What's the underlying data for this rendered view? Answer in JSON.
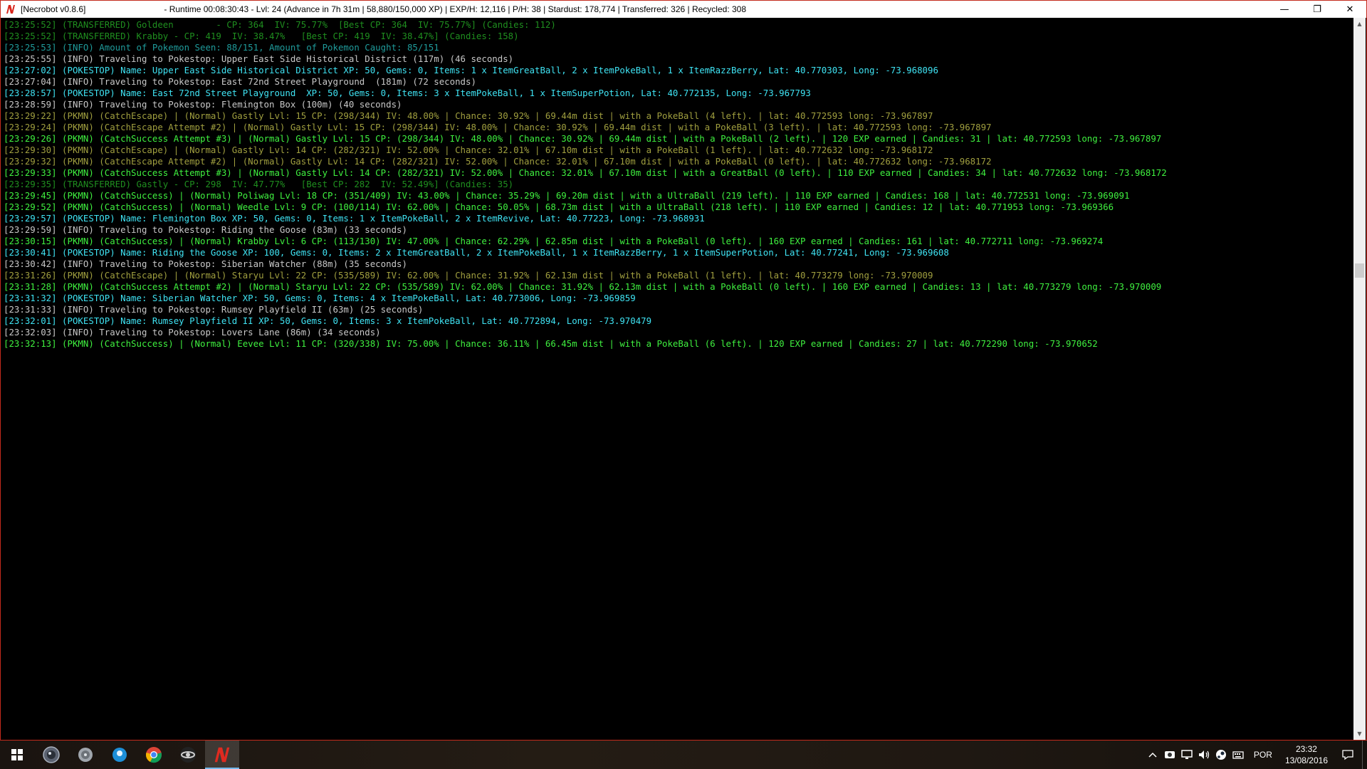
{
  "window": {
    "title": "[Necrobot v0.8.6]",
    "status": "- Runtime 00:08:30:43 - Lvl: 24 (Advance in 7h 31m | 58,880/150,000 XP) | EXP/H: 12,116 | P/H: 38 | Stardust: 178,774 | Transferred: 326 | Recycled: 308",
    "minimize": "—",
    "restore": "❐",
    "close": "✕",
    "app_icon": "necrobot-logo-icon"
  },
  "console": {
    "lines": [
      {
        "text": "[23:25:52] (TRANSFERRED) Goldeen        - CP: 364  IV: 75.77%  [Best CP: 364  IV: 75.77%] (Candies: 112)",
        "color": "dkgreen"
      },
      {
        "text": "[23:25:52] (TRANSFERRED) Krabby - CP: 419  IV: 38.47%   [Best CP: 419  IV: 38.47%] (Candies: 158)",
        "color": "dkgreen"
      },
      {
        "text": "[23:25:53] (INFO) Amount of Pokemon Seen: 88/151, Amount of Pokemon Caught: 85/151",
        "color": "dkcyan"
      },
      {
        "text": "[23:25:55] (INFO) Traveling to Pokestop: Upper East Side Historical District (117m) (46 seconds)",
        "color": "white"
      },
      {
        "text": "[23:27:02] (POKESTOP) Name: Upper East Side Historical District XP: 50, Gems: 0, Items: 1 x ItemGreatBall, 2 x ItemPokeBall, 1 x ItemRazzBerry, Lat: 40.770303, Long: -73.968096",
        "color": "cyan"
      },
      {
        "text": "[23:27:04] (INFO) Traveling to Pokestop: East 72nd Street Playground  (181m) (72 seconds)",
        "color": "white"
      },
      {
        "text": "[23:28:57] (POKESTOP) Name: East 72nd Street Playground  XP: 50, Gems: 0, Items: 3 x ItemPokeBall, 1 x ItemSuperPotion, Lat: 40.772135, Long: -73.967793",
        "color": "cyan"
      },
      {
        "text": "[23:28:59] (INFO) Traveling to Pokestop: Flemington Box (100m) (40 seconds)",
        "color": "white"
      },
      {
        "text": "[23:29:22] (PKMN) (CatchEscape) | (Normal) Gastly Lvl: 15 CP: (298/344) IV: 48.00% | Chance: 30.92% | 69.44m dist | with a PokeBall (4 left). | lat: 40.772593 long: -73.967897",
        "color": "olive"
      },
      {
        "text": "[23:29:24] (PKMN) (CatchEscape Attempt #2) | (Normal) Gastly Lvl: 15 CP: (298/344) IV: 48.00% | Chance: 30.92% | 69.44m dist | with a PokeBall (3 left). | lat: 40.772593 long: -73.967897",
        "color": "olive"
      },
      {
        "text": "[23:29:26] (PKMN) (CatchSuccess Attempt #3) | (Normal) Gastly Lvl: 15 CP: (298/344) IV: 48.00% | Chance: 30.92% | 69.44m dist | with a PokeBall (2 left). | 120 EXP earned | Candies: 31 | lat: 40.772593 long: -73.967897",
        "color": "green"
      },
      {
        "text": "[23:29:30] (PKMN) (CatchEscape) | (Normal) Gastly Lvl: 14 CP: (282/321) IV: 52.00% | Chance: 32.01% | 67.10m dist | with a PokeBall (1 left). | lat: 40.772632 long: -73.968172",
        "color": "olive"
      },
      {
        "text": "[23:29:32] (PKMN) (CatchEscape Attempt #2) | (Normal) Gastly Lvl: 14 CP: (282/321) IV: 52.00% | Chance: 32.01% | 67.10m dist | with a PokeBall (0 left). | lat: 40.772632 long: -73.968172",
        "color": "olive"
      },
      {
        "text": "[23:29:33] (PKMN) (CatchSuccess Attempt #3) | (Normal) Gastly Lvl: 14 CP: (282/321) IV: 52.00% | Chance: 32.01% | 67.10m dist | with a GreatBall (0 left). | 110 EXP earned | Candies: 34 | lat: 40.772632 long: -73.968172",
        "color": "green"
      },
      {
        "text": "[23:29:35] (TRANSFERRED) Gastly - CP: 298  IV: 47.77%   [Best CP: 282  IV: 52.49%] (Candies: 35)",
        "color": "dkgreen"
      },
      {
        "text": "[23:29:45] (PKMN) (CatchSuccess) | (Normal) Poliwag Lvl: 18 CP: (351/409) IV: 43.00% | Chance: 35.29% | 69.20m dist | with a UltraBall (219 left). | 110 EXP earned | Candies: 168 | lat: 40.772531 long: -73.969091",
        "color": "green"
      },
      {
        "text": "[23:29:52] (PKMN) (CatchSuccess) | (Normal) Weedle Lvl: 9 CP: (100/114) IV: 62.00% | Chance: 50.05% | 68.73m dist | with a UltraBall (218 left). | 110 EXP earned | Candies: 12 | lat: 40.771953 long: -73.969366",
        "color": "green"
      },
      {
        "text": "[23:29:57] (POKESTOP) Name: Flemington Box XP: 50, Gems: 0, Items: 1 x ItemPokeBall, 2 x ItemRevive, Lat: 40.77223, Long: -73.968931",
        "color": "cyan"
      },
      {
        "text": "[23:29:59] (INFO) Traveling to Pokestop: Riding the Goose (83m) (33 seconds)",
        "color": "white"
      },
      {
        "text": "[23:30:15] (PKMN) (CatchSuccess) | (Normal) Krabby Lvl: 6 CP: (113/130) IV: 47.00% | Chance: 62.29% | 62.85m dist | with a PokeBall (0 left). | 160 EXP earned | Candies: 161 | lat: 40.772711 long: -73.969274",
        "color": "green"
      },
      {
        "text": "[23:30:41] (POKESTOP) Name: Riding the Goose XP: 100, Gems: 0, Items: 2 x ItemGreatBall, 2 x ItemPokeBall, 1 x ItemRazzBerry, 1 x ItemSuperPotion, Lat: 40.77241, Long: -73.969608",
        "color": "cyan"
      },
      {
        "text": "[23:30:42] (INFO) Traveling to Pokestop: Siberian Watcher (88m) (35 seconds)",
        "color": "white"
      },
      {
        "text": "[23:31:26] (PKMN) (CatchEscape) | (Normal) Staryu Lvl: 22 CP: (535/589) IV: 62.00% | Chance: 31.92% | 62.13m dist | with a PokeBall (1 left). | lat: 40.773279 long: -73.970009",
        "color": "olive"
      },
      {
        "text": "[23:31:28] (PKMN) (CatchSuccess Attempt #2) | (Normal) Staryu Lvl: 22 CP: (535/589) IV: 62.00% | Chance: 31.92% | 62.13m dist | with a PokeBall (0 left). | 160 EXP earned | Candies: 13 | lat: 40.773279 long: -73.970009",
        "color": "green"
      },
      {
        "text": "[23:31:32] (POKESTOP) Name: Siberian Watcher XP: 50, Gems: 0, Items: 4 x ItemPokeBall, Lat: 40.773006, Long: -73.969859",
        "color": "cyan"
      },
      {
        "text": "[23:31:33] (INFO) Traveling to Pokestop: Rumsey Playfield II (63m) (25 seconds)",
        "color": "white"
      },
      {
        "text": "[23:32:01] (POKESTOP) Name: Rumsey Playfield II XP: 50, Gems: 0, Items: 3 x ItemPokeBall, Lat: 40.772894, Long: -73.970479",
        "color": "cyan"
      },
      {
        "text": "[23:32:03] (INFO) Traveling to Pokestop: Lovers Lane (86m) (34 seconds)",
        "color": "white"
      },
      {
        "text": "[23:32:13] (PKMN) (CatchSuccess) | (Normal) Eevee Lvl: 11 CP: (320/338) IV: 75.00% | Chance: 36.11% | 66.45m dist | with a PokeBall (6 left). | 120 EXP earned | Candies: 27 | lat: 40.772290 long: -73.970652",
        "color": "green"
      }
    ]
  },
  "taskbar": {
    "items": [
      {
        "name": "start-windows-icon",
        "active": false
      },
      {
        "name": "pokeball-app-icon",
        "active": false
      },
      {
        "name": "disc-app-icon",
        "active": false
      },
      {
        "name": "blue-app-icon",
        "active": false
      },
      {
        "name": "chrome-icon",
        "active": false
      },
      {
        "name": "steam-app-icon",
        "active": false
      },
      {
        "name": "necrobot-app-icon",
        "active": true
      }
    ],
    "tray": {
      "language": "POR",
      "time": "23:32",
      "date": "13/08/2016"
    }
  },
  "colors": {
    "dkgreen": "#1f8f1f",
    "dkcyan": "#1f9b9b",
    "white": "#c8c8c8",
    "cyan": "#3fe3f3",
    "green": "#3ff03f",
    "olive": "#a09f3f",
    "accent": "#c42b1c"
  }
}
